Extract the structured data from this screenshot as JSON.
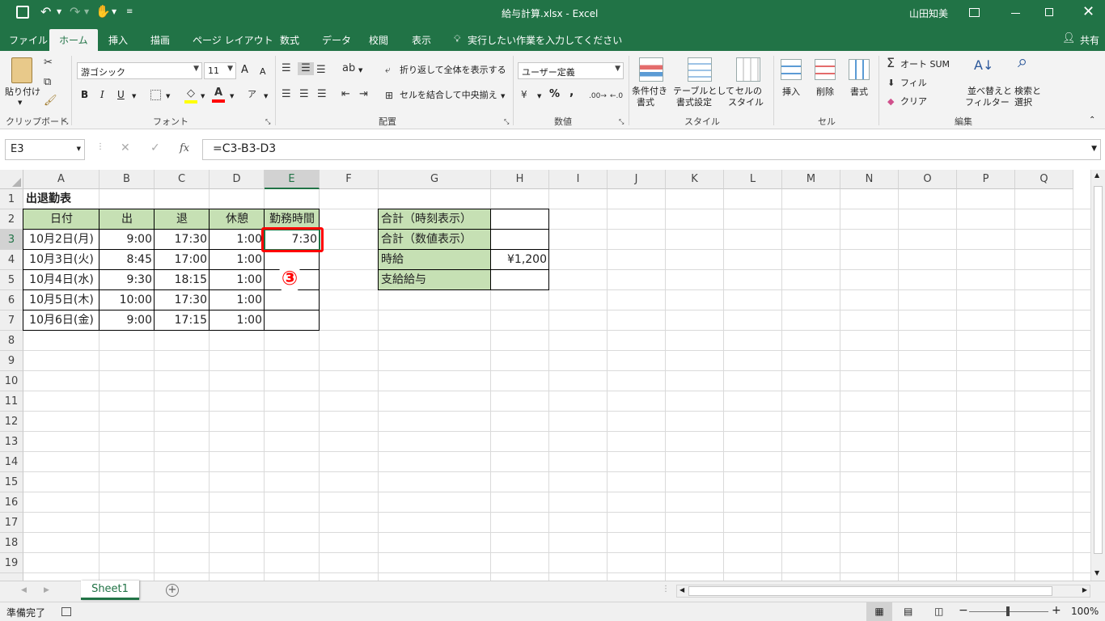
{
  "window": {
    "title": "給与計算.xlsx  -  Excel",
    "user": "山田知美"
  },
  "tabs": [
    "ファイル",
    "ホーム",
    "挿入",
    "描画",
    "ページ レイアウト",
    "数式",
    "データ",
    "校閲",
    "表示"
  ],
  "tell_me": "実行したい作業を入力してください",
  "share": "共有",
  "ribbon": {
    "clipboard": {
      "paste": "貼り付け",
      "label": "クリップボード"
    },
    "font": {
      "name": "游ゴシック",
      "size": "11",
      "label": "フォント",
      "bold": "B",
      "italic": "I",
      "underline": "U",
      "grow": "A",
      "shrink": "A"
    },
    "alignment": {
      "wrap": "折り返して全体を表示する",
      "merge": "セルを結合して中央揃え",
      "label": "配置"
    },
    "number": {
      "format": "ユーザー定義",
      "percent": "%",
      "comma": ",",
      "label": "数値"
    },
    "styles": {
      "conditional_1": "条件付き",
      "conditional_2": "書式",
      "table_1": "テーブルとして",
      "table_2": "書式設定",
      "cell_1": "セルの",
      "cell_2": "スタイル",
      "label": "スタイル"
    },
    "cells": {
      "insert": "挿入",
      "delete": "削除",
      "format": "書式",
      "label": "セル"
    },
    "editing": {
      "autosum": "オート SUM",
      "fill": "フィル",
      "clear": "クリア",
      "sort_1": "並べ替えと",
      "sort_2": "フィルター",
      "find_1": "検索と",
      "find_2": "選択",
      "label": "編集"
    }
  },
  "formula_bar": {
    "name_box": "E3",
    "formula": "=C3-B3-D3",
    "fx": "fx"
  },
  "columns": [
    "A",
    "B",
    "C",
    "D",
    "E",
    "F",
    "G",
    "H",
    "I",
    "J",
    "K",
    "L",
    "M",
    "N",
    "O",
    "P",
    "Q"
  ],
  "rows": [
    "1",
    "2",
    "3",
    "4",
    "5",
    "6",
    "7",
    "8",
    "9",
    "10",
    "11",
    "12",
    "13",
    "14",
    "15",
    "16",
    "17",
    "18",
    "19"
  ],
  "sheet": {
    "title": "出退勤表",
    "headers": [
      "日付",
      "出",
      "退",
      "休憩",
      "勤務時間"
    ],
    "data": [
      [
        "10月2日(月)",
        "9:00",
        "17:30",
        "1:00",
        "7:30"
      ],
      [
        "10月3日(火)",
        "8:45",
        "17:00",
        "1:00",
        ""
      ],
      [
        "10月4日(水)",
        "9:30",
        "18:15",
        "1:00",
        ""
      ],
      [
        "10月5日(木)",
        "10:00",
        "17:30",
        "1:00",
        ""
      ],
      [
        "10月6日(金)",
        "9:00",
        "17:15",
        "1:00",
        ""
      ]
    ],
    "summary": [
      {
        "label": "合計（時刻表示）",
        "value": ""
      },
      {
        "label": "合計（数値表示）",
        "value": ""
      },
      {
        "label": "時給",
        "value": "¥1,200"
      },
      {
        "label": "支給給与",
        "value": ""
      }
    ]
  },
  "annotation": "③",
  "sheet_tab": "Sheet1",
  "status": {
    "ready": "準備完了",
    "zoom": "100%"
  },
  "colors": {
    "excel_green": "#217346",
    "header_fill": "#c6e0b4",
    "annotation_red": "#ff0000"
  }
}
